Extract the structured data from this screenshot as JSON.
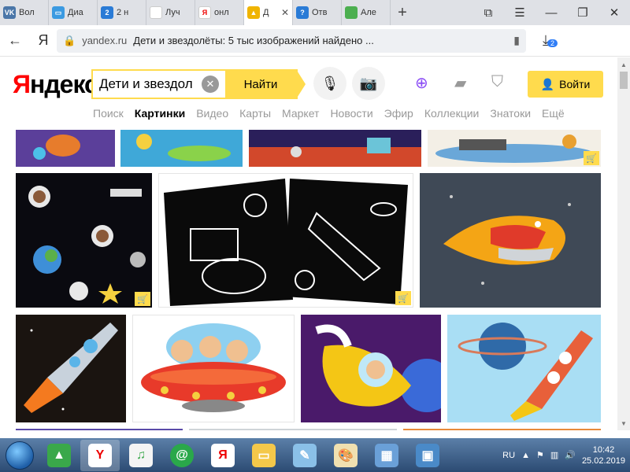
{
  "tabs": [
    {
      "label": "Вол",
      "favicon": "vk-icon",
      "color": "#4a76a8",
      "glyph": "VK"
    },
    {
      "label": "Диа",
      "favicon": "chat-icon",
      "color": "#3b9ae1",
      "glyph": "▭"
    },
    {
      "label": "2 н",
      "favicon": "number-icon",
      "color": "#2a7bd6",
      "glyph": "2"
    },
    {
      "label": "Луч",
      "favicon": "page-icon",
      "color": "#ffffff",
      "glyph": ""
    },
    {
      "label": "онл",
      "favicon": "yandex-icon",
      "color": "#ffffff",
      "glyph": "Я"
    },
    {
      "label": "Д",
      "favicon": "images-icon",
      "color": "#f0b400",
      "glyph": "▲"
    },
    {
      "label": "Отв",
      "favicon": "question-icon",
      "color": "#2a7bd6",
      "glyph": "?"
    },
    {
      "label": "Але",
      "favicon": "green-square-icon",
      "color": "#4caf50",
      "glyph": ""
    }
  ],
  "address": {
    "domain": "yandex.ru",
    "title": "Дети и звездолёты: 5 тыс изображений найдено ...",
    "downloads_badge": "2"
  },
  "logo": {
    "first": "Я",
    "rest": "ндекс"
  },
  "search": {
    "query": "Дети и звездол",
    "button": "Найти"
  },
  "login_label": "Войти",
  "services": [
    "Поиск",
    "Картинки",
    "Видео",
    "Карты",
    "Маркет",
    "Новости",
    "Эфир",
    "Коллекции",
    "Знатоки",
    "Ещё"
  ],
  "active_service": "Картинки",
  "taskbar": {
    "lang": "RU",
    "time": "10:42",
    "date": "25.02.2019"
  },
  "colors": {
    "yandex_yellow": "#ffdb4d",
    "yandex_red": "#ff0000"
  }
}
